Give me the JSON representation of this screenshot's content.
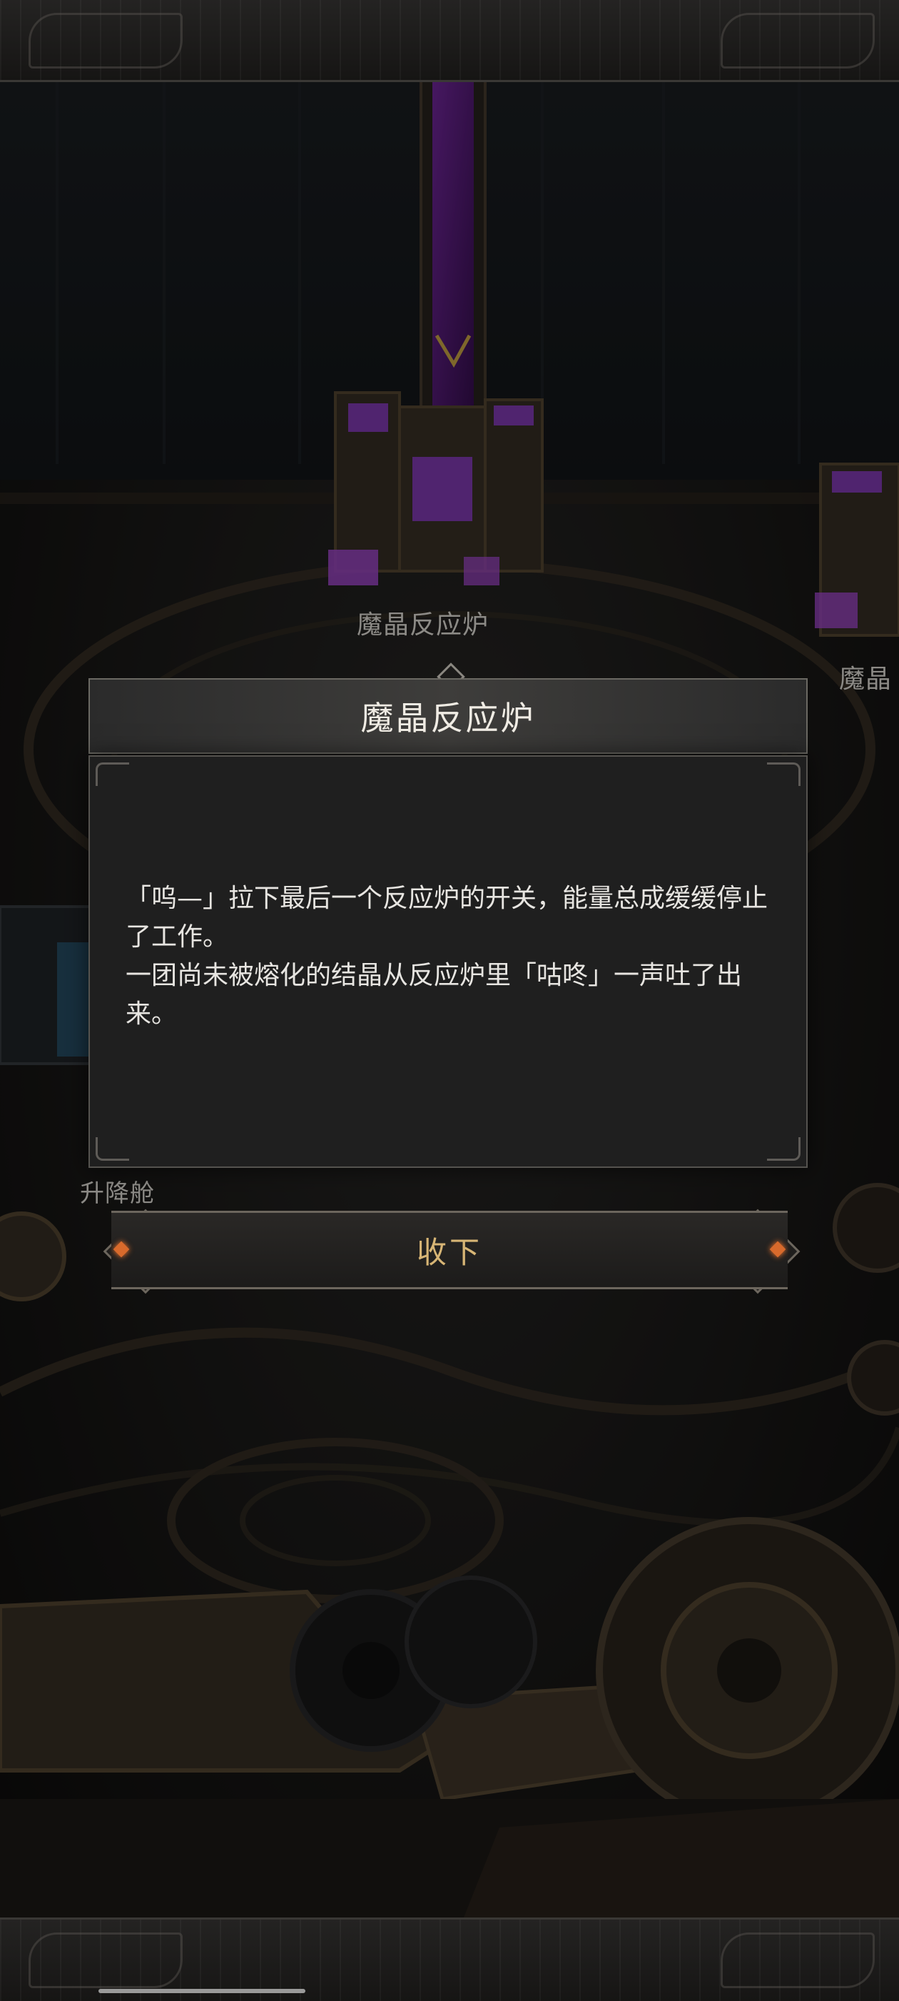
{
  "map": {
    "labels": {
      "reactor_1": "魔晶反应炉",
      "reactor_2": "魔晶",
      "elevator": "升降舱"
    }
  },
  "dialog": {
    "title": "魔晶反应炉",
    "lines": [
      "「呜—」拉下最后一个反应炉的开关，能量总成缓缓停止了工作。",
      "一团尚未被熔化的结晶从反应炉里「咕咚」一声吐了出来。"
    ],
    "accept_label": "收下"
  },
  "colors": {
    "accent_gold": "#d7b575",
    "gem_orange": "#d86a2c",
    "crystal_purple": "#9b3fd1"
  }
}
